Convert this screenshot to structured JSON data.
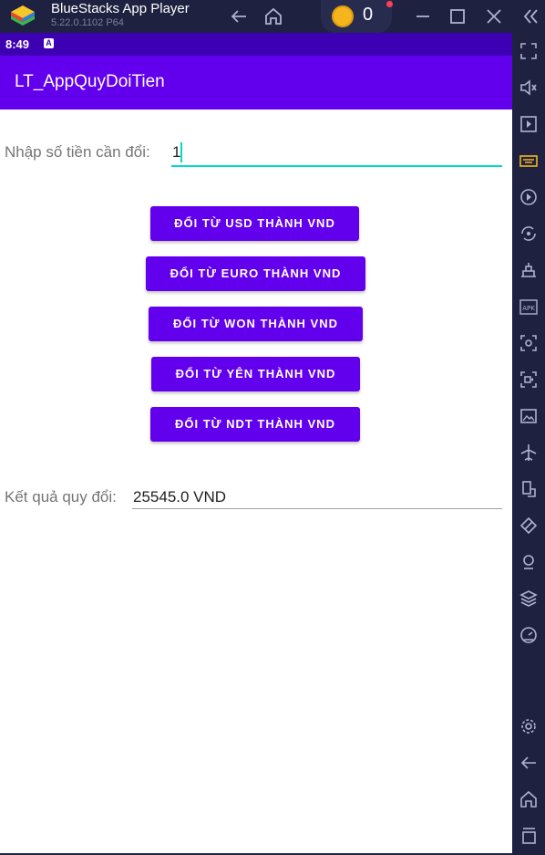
{
  "window": {
    "title": "BlueStacks App Player",
    "version": "5.22.0.1102  P64",
    "coins": "0",
    "icons": [
      "back-arrow-icon",
      "home-icon",
      "coin-icon",
      "minimize-icon",
      "maximize-icon",
      "close-icon",
      "collapse-icon"
    ]
  },
  "sidebar": {
    "icons": [
      "fullscreen-icon",
      "volume-icon",
      "media-icon",
      "keyboard-icon",
      "macro-play-icon",
      "rotate-icon",
      "build-icon",
      "apk-icon",
      "screenshot-icon",
      "record-icon",
      "gallery-icon",
      "airplane-icon",
      "multi-instance-icon",
      "eco-mode-icon",
      "location-icon",
      "layers-icon",
      "speed-icon",
      "settings-icon",
      "back-icon",
      "home-icon",
      "recents-icon"
    ]
  },
  "status_bar": {
    "time": "8:49",
    "notification_letter": "A"
  },
  "app": {
    "title": "LT_AppQuyDoiTien",
    "amount_label": "Nhập số tiền cần đổi:",
    "amount_value": "1",
    "buttons": [
      {
        "label": "ĐỔI TỪ USD THÀNH VND"
      },
      {
        "label": "ĐỔI TỪ EURO THÀNH VND"
      },
      {
        "label": "ĐỔI TỪ WON THÀNH VND"
      },
      {
        "label": "ĐỔI TỪ YÊN THÀNH VND"
      },
      {
        "label": "ĐỔI TỪ NDT THÀNH VND"
      }
    ],
    "result_label": "Kết quả quy đổi:",
    "result_value": "25545.0 VND"
  },
  "colors": {
    "primary": "#6200ee",
    "primary_dark": "#3e00b3",
    "accent": "#03dac5",
    "chrome": "#1e2240"
  }
}
